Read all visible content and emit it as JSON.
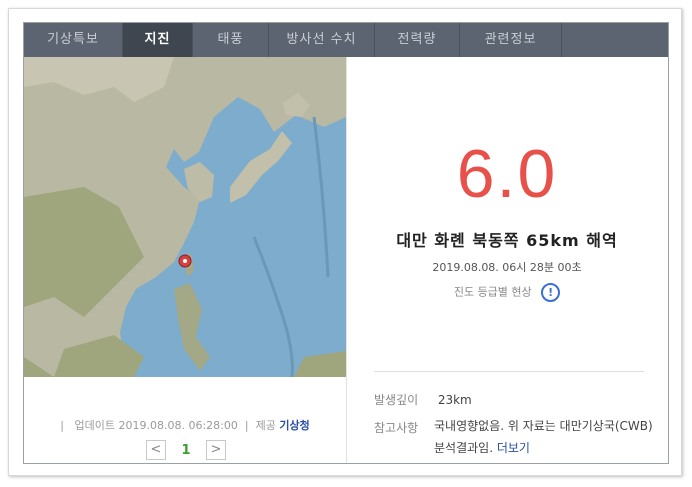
{
  "tabs": [
    {
      "label": "기상특보",
      "active": false
    },
    {
      "label": "지진",
      "active": true
    },
    {
      "label": "태풍",
      "active": false
    },
    {
      "label": "방사선 수치",
      "active": false
    },
    {
      "label": "전력량",
      "active": false
    },
    {
      "label": "관련정보",
      "active": false
    }
  ],
  "map": {
    "marker_icon": "location-pin-icon",
    "marker_color": "#d94040"
  },
  "earthquake": {
    "magnitude": "6.0",
    "location": "대만 화롄 북동쪽 65km 해역",
    "datetime": "2019.08.08. 06시 28분 00초",
    "intensity_label": "진도 등급별 현상",
    "depth_label": "발생깊이",
    "depth_value": "23km",
    "notes_label": "참고사항",
    "notes_text": "국내영향없음. 위 자료는 대만기상국(CWB) 분석결과임.",
    "more_link": "더보기"
  },
  "footer": {
    "update_prefix": "업데이트",
    "update_time": "2019.08.08. 06:28:00",
    "provider_prefix": "제공",
    "provider_name": "기상청",
    "page_number": "1",
    "prev_symbol": "<",
    "next_symbol": ">"
  },
  "colors": {
    "magnitude": "#e8504a",
    "tab_bar": "#5b6470",
    "tab_active": "#3f4650",
    "link": "#2b4ea8"
  }
}
